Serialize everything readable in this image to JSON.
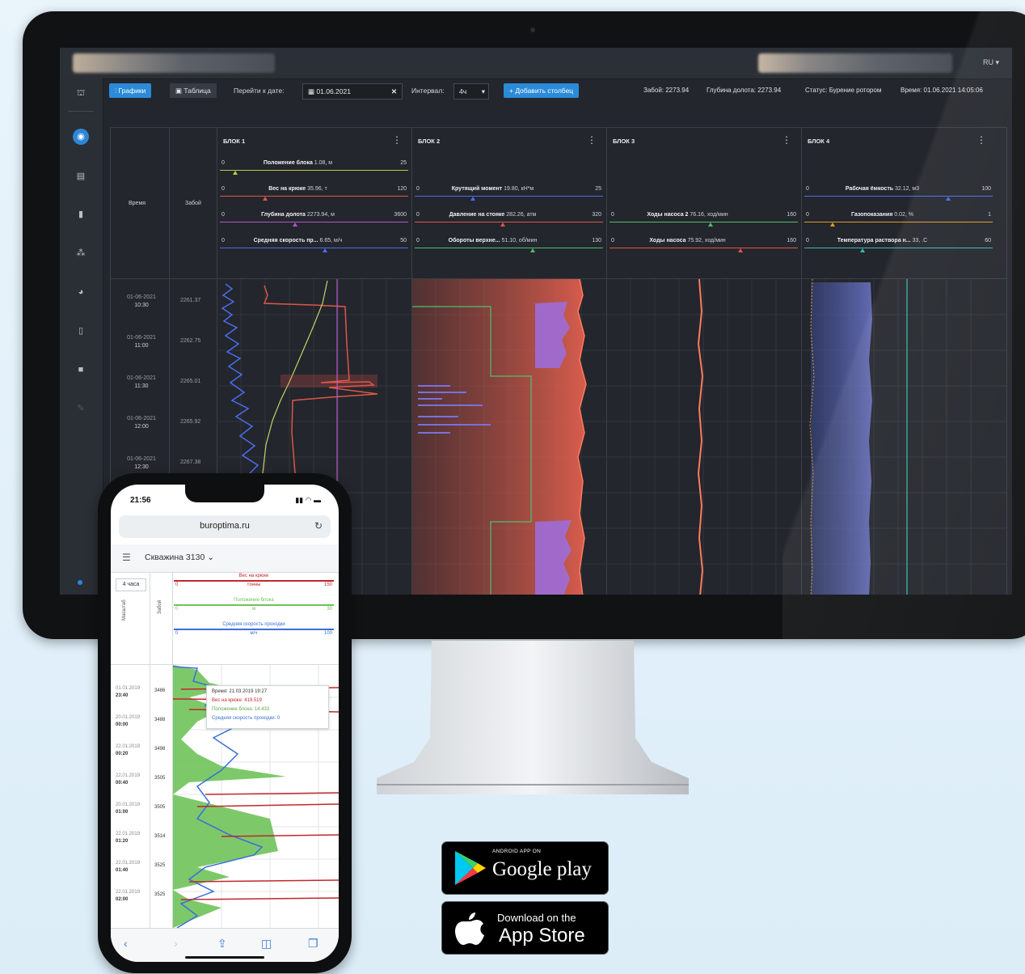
{
  "desktop": {
    "lang": "RU",
    "toolbar": {
      "charts_tab": "Графики",
      "table_tab": "Таблица",
      "goto_date_label": "Перейти к дате:",
      "date_value": "01.06.2021",
      "interval_label": "Интервал:",
      "interval_value": "4ч",
      "add_column_button": "+ Добавить столбец"
    },
    "status": {
      "zaboi": "Забой: 2273.94",
      "bit_depth": "Глубина долота: 2273.94",
      "state": "Статус: Бурение ротором",
      "time": "Время: 01.06.2021 14:05:06"
    },
    "columns": {
      "time": "Время",
      "zaboi": "Забой"
    },
    "blocks": [
      {
        "name": "БЛОК 1",
        "params": [
          {
            "label": "Положение блока",
            "value": "1.08, м",
            "min": "0",
            "max": "25",
            "color": "#b9c94a"
          },
          {
            "label": "Вес на крюке",
            "value": "35.96, т",
            "min": "0",
            "max": "120",
            "color": "#e0554a"
          },
          {
            "label": "Глубина долота",
            "value": "2273.94, м",
            "min": "0",
            "max": "3600",
            "color": "#b257c7"
          },
          {
            "label": "Средняя скорость пр...",
            "value": "6.65, м/ч",
            "min": "0",
            "max": "50",
            "color": "#4c6cf0"
          }
        ]
      },
      {
        "name": "БЛОК 2",
        "params": [
          {
            "label": "Крутящий момент",
            "value": "19.80, кН*м",
            "min": "0",
            "max": "25",
            "color": "#4c6cf0"
          },
          {
            "label": "Давление на стояке",
            "value": "282.26, атм",
            "min": "0",
            "max": "320",
            "color": "#e0554a"
          },
          {
            "label": "Обороты верхне...",
            "value": "51.10, об/мин",
            "min": "0",
            "max": "130",
            "color": "#4fbf6a"
          }
        ]
      },
      {
        "name": "БЛОК 3",
        "params": [
          {
            "label": "Ходы насоса 2",
            "value": "76.16, ход/мин",
            "min": "0",
            "max": "160",
            "color": "#4fbf6a"
          },
          {
            "label": "Ходы насоса",
            "value": "75.92, ход/мин",
            "min": "0",
            "max": "160",
            "color": "#e0554a"
          }
        ]
      },
      {
        "name": "БЛОК 4",
        "params": [
          {
            "label": "Рабочая ёмкость",
            "value": "32.12, м3",
            "min": "0",
            "max": "100",
            "color": "#4c6cf0"
          },
          {
            "label": "Газопоказания",
            "value": "0.02, %",
            "min": "0",
            "max": "1",
            "color": "#e09a2a"
          },
          {
            "label": "Температура раствора н...",
            "value": "33, .С",
            "min": "0",
            "max": "60",
            "color": "#3cb8b0"
          }
        ]
      }
    ],
    "rows": [
      {
        "date": "01-06-2021",
        "time": "10:30",
        "zaboi": "2261.37"
      },
      {
        "date": "01-06-2021",
        "time": "11:00",
        "zaboi": "2262.75"
      },
      {
        "date": "01-06-2021",
        "time": "11:30",
        "zaboi": "2265.01"
      },
      {
        "date": "01-06-2021",
        "time": "12:00",
        "zaboi": "2265.92"
      },
      {
        "date": "01-06-2021",
        "time": "12:30",
        "zaboi": "2267.38"
      }
    ]
  },
  "phone": {
    "clock": "21:56",
    "url": "buroptima.ru",
    "well": "Скважина 3130",
    "interval": "4 часа",
    "col_masshtab": "Масштаб",
    "col_zaboi": "Забой",
    "legend": [
      {
        "name": "Вес на крюке",
        "unit": "тонны",
        "min": "0",
        "max": "150",
        "color": "#c0282d"
      },
      {
        "name": "Положение блока",
        "unit": "м",
        "min": "0",
        "max": "30",
        "color": "#6fc35a"
      },
      {
        "name": "Средняя скорость проходки",
        "unit": "м/ч",
        "min": "0",
        "max": "100",
        "color": "#3a6fd9"
      }
    ],
    "tooltip": {
      "time": "Время: 21.03.2019 19:27",
      "hook": "Вес на крюке: 419.519",
      "block": "Положение блока: 14.433",
      "speed": "Средняя скорость проходки: 0"
    },
    "rows": [
      {
        "date": "01.01.2019",
        "time": "23:40",
        "zaboi": "3486"
      },
      {
        "date": "20.01.2019",
        "time": "00:00",
        "zaboi": "3488"
      },
      {
        "date": "22.01.2019",
        "time": "00:20",
        "zaboi": "3498"
      },
      {
        "date": "22.01.2019",
        "time": "00:40",
        "zaboi": "3505"
      },
      {
        "date": "20.01.2019",
        "time": "01:00",
        "zaboi": "3505"
      },
      {
        "date": "22.01.2019",
        "time": "01:20",
        "zaboi": "3514"
      },
      {
        "date": "22.01.2019",
        "time": "01:40",
        "zaboi": "3525"
      },
      {
        "date": "22.01.2019",
        "time": "02:00",
        "zaboi": "3525"
      }
    ]
  },
  "badges": {
    "google_small": "ANDROID APP ON",
    "google_big": "Google play",
    "apple_small": "Download on the",
    "apple_big": "App Store"
  }
}
